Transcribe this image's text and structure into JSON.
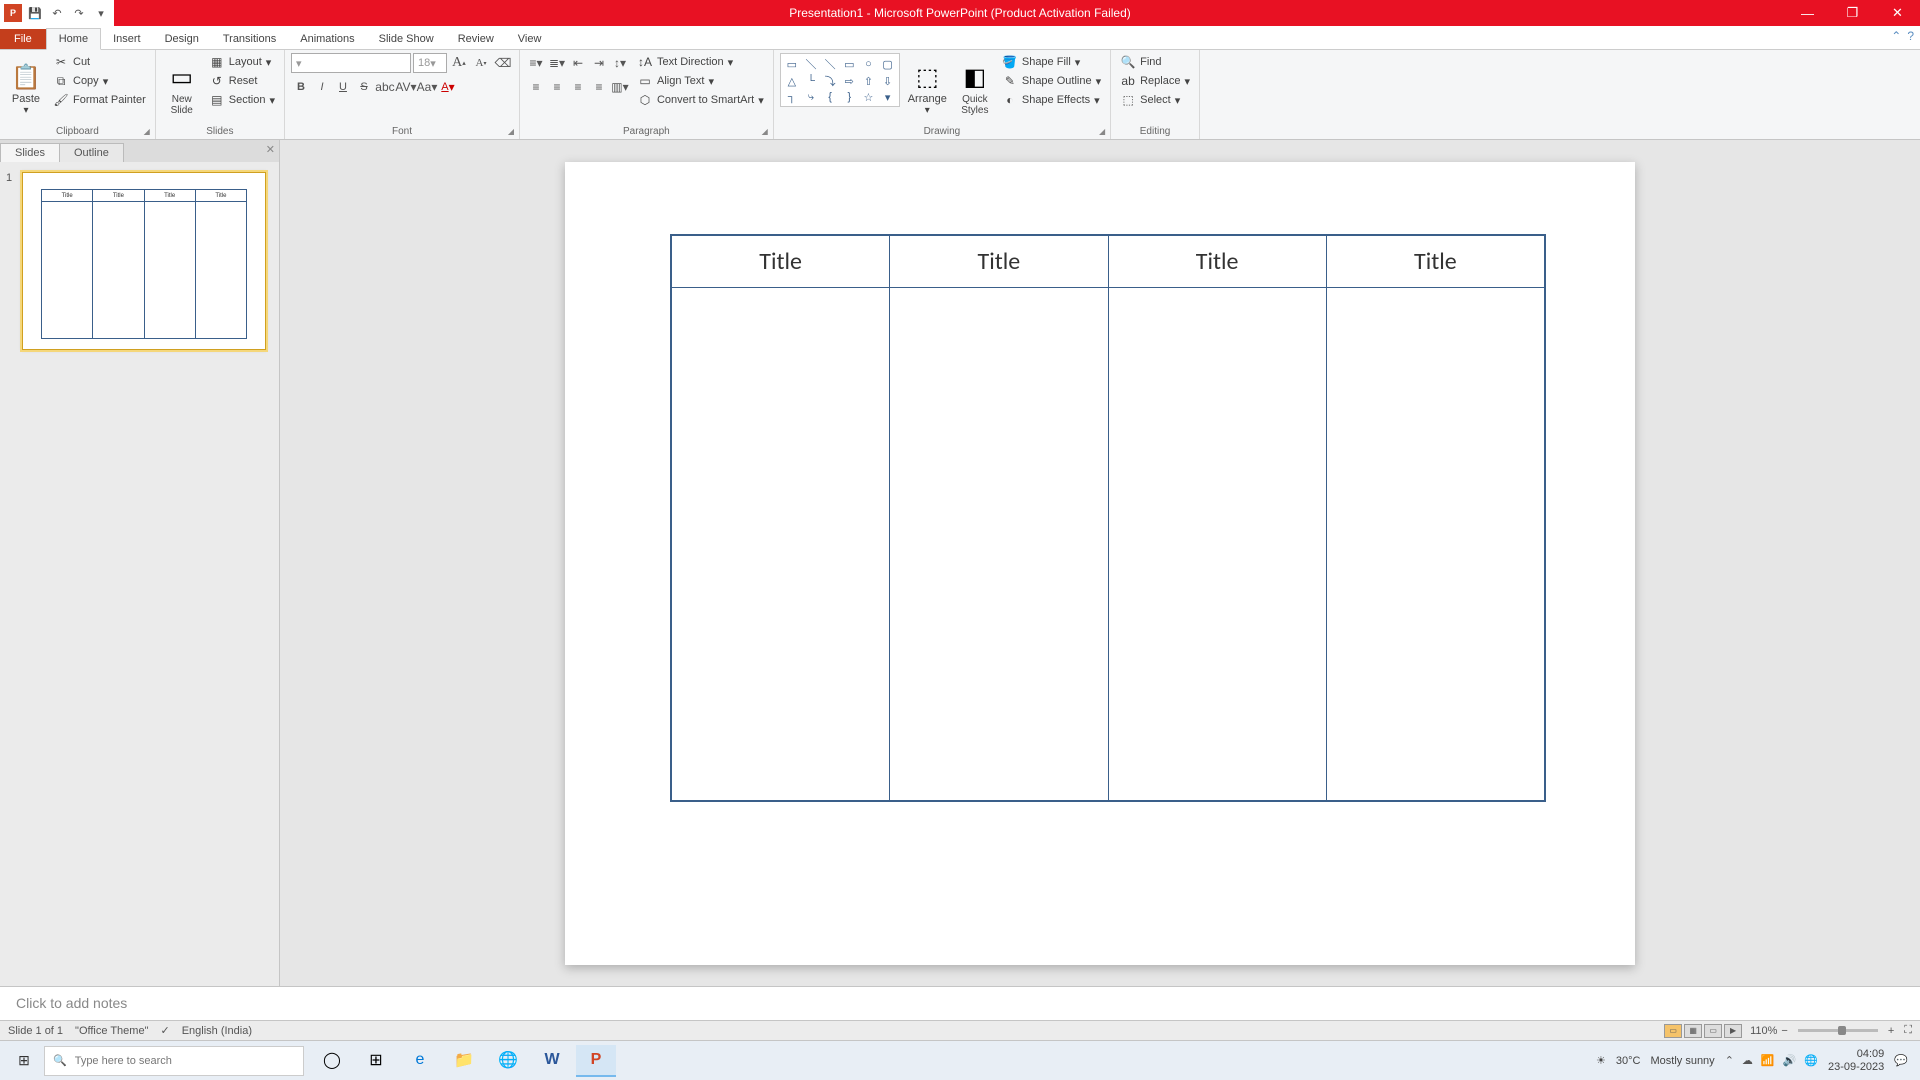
{
  "title": "Presentation1 - Microsoft PowerPoint (Product Activation Failed)",
  "qat": {
    "undo": "↶",
    "redo": "↷"
  },
  "tabs": {
    "file": "File",
    "home": "Home",
    "insert": "Insert",
    "design": "Design",
    "transitions": "Transitions",
    "animations": "Animations",
    "slideshow": "Slide Show",
    "review": "Review",
    "view": "View"
  },
  "ribbon": {
    "clipboard": {
      "label": "Clipboard",
      "paste": "Paste",
      "cut": "Cut",
      "copy": "Copy",
      "format_painter": "Format Painter"
    },
    "slides": {
      "label": "Slides",
      "new_slide": "New\nSlide",
      "layout": "Layout",
      "reset": "Reset",
      "section": "Section"
    },
    "font": {
      "label": "Font",
      "size": "18"
    },
    "paragraph": {
      "label": "Paragraph",
      "text_direction": "Text Direction",
      "align_text": "Align Text",
      "convert_smartart": "Convert to SmartArt"
    },
    "drawing": {
      "label": "Drawing",
      "arrange": "Arrange",
      "quick_styles": "Quick\nStyles",
      "shape_fill": "Shape Fill",
      "shape_outline": "Shape Outline",
      "shape_effects": "Shape Effects"
    },
    "editing": {
      "label": "Editing",
      "find": "Find",
      "replace": "Replace",
      "select": "Select"
    }
  },
  "panel": {
    "slides_tab": "Slides",
    "outline_tab": "Outline",
    "thumb_num": "1",
    "thumb_title": "Title"
  },
  "slide": {
    "col1": "Title",
    "col2": "Title",
    "col3": "Title",
    "col4": "Title"
  },
  "notes": {
    "placeholder": "Click to add notes"
  },
  "status": {
    "slide": "Slide 1 of 1",
    "theme": "\"Office Theme\"",
    "lang": "English (India)",
    "zoom": "110%"
  },
  "taskbar": {
    "search_placeholder": "Type here to search",
    "weather_temp": "30°C",
    "weather_desc": "Mostly sunny",
    "time": "04:09",
    "date": "23-09-2023"
  }
}
